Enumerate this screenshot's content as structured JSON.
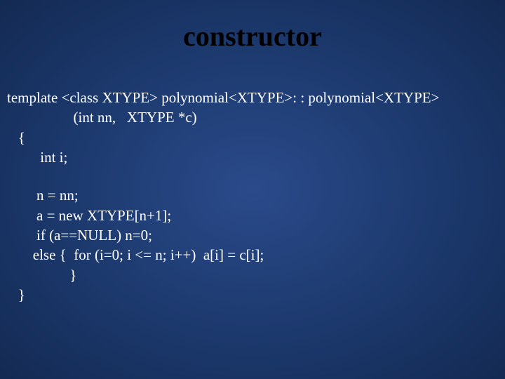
{
  "title": "constructor",
  "code": {
    "l1": "template <class XTYPE> polynomial<XTYPE>: : polynomial<XTYPE>",
    "l2": "                  (int nn,   XTYPE *c)",
    "l3": "   {",
    "l4": "         int i;",
    "l5": "        n = nn;",
    "l6": "        a = new XTYPE[n+1];",
    "l7": "        if (a==NULL) n=0;",
    "l8": "       else {  for (i=0; i <= n; i++)  a[i] = c[i];",
    "l9": "                 }",
    "l10": "   }"
  }
}
